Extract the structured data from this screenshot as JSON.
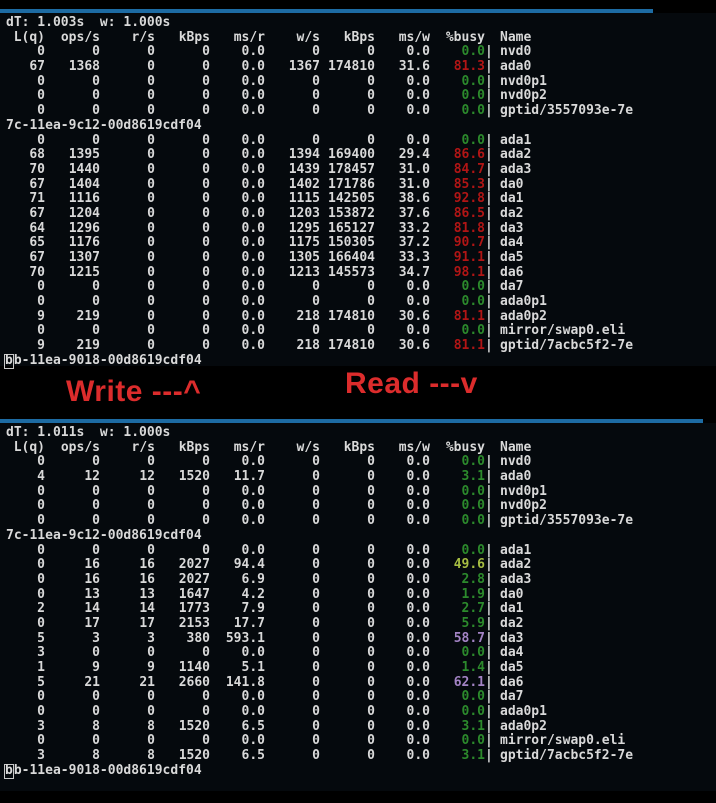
{
  "colors": {
    "page_bg": "#000000",
    "terminal_bg": "#05090d",
    "text": "#d9d9d9",
    "accent_bar": "#1d6ba3",
    "annotation_red": "#dc2c2c",
    "busy": {
      "green": "#2c8a2c",
      "lime": "#a6bd42",
      "purple": "#a383c4",
      "red": "#b11515"
    }
  },
  "annotations": {
    "write_label": "Write ---^",
    "read_label": "Read ---v"
  },
  "columns": [
    "L(q)",
    "ops/s",
    "r/s",
    "kBps",
    "ms/r",
    "w/s",
    "kBps",
    "ms/w",
    "%busy",
    "Name"
  ],
  "terminals": [
    {
      "id": "write",
      "dt_line": "dT: 1.003s  w: 1.000s",
      "rows": [
        [
          "0",
          "0",
          "0",
          "0",
          "0.0",
          "0",
          "0",
          "0.0",
          "0.0",
          "green",
          "nvd0"
        ],
        [
          "67",
          "1368",
          "0",
          "0",
          "0.0",
          "1367",
          "174810",
          "31.6",
          "81.3",
          "red",
          "ada0"
        ],
        [
          "0",
          "0",
          "0",
          "0",
          "0.0",
          "0",
          "0",
          "0.0",
          "0.0",
          "green",
          "nvd0p1"
        ],
        [
          "0",
          "0",
          "0",
          "0",
          "0.0",
          "0",
          "0",
          "0.0",
          "0.0",
          "green",
          "nvd0p2"
        ],
        [
          "0",
          "0",
          "0",
          "0",
          "0.0",
          "0",
          "0",
          "0.0",
          "0.0",
          "green",
          "gptid/3557093e-7e"
        ],
        {
          "wrap": "7c-11ea-9c12-00d8619cdf04",
          "cursor": false
        },
        [
          "0",
          "0",
          "0",
          "0",
          "0.0",
          "0",
          "0",
          "0.0",
          "0.0",
          "green",
          "ada1"
        ],
        [
          "68",
          "1395",
          "0",
          "0",
          "0.0",
          "1394",
          "169400",
          "29.4",
          "86.6",
          "red",
          "ada2"
        ],
        [
          "70",
          "1440",
          "0",
          "0",
          "0.0",
          "1439",
          "178457",
          "31.0",
          "84.7",
          "red",
          "ada3"
        ],
        [
          "67",
          "1404",
          "0",
          "0",
          "0.0",
          "1402",
          "171786",
          "31.0",
          "85.3",
          "red",
          "da0"
        ],
        [
          "71",
          "1116",
          "0",
          "0",
          "0.0",
          "1115",
          "142505",
          "38.6",
          "92.8",
          "red",
          "da1"
        ],
        [
          "67",
          "1204",
          "0",
          "0",
          "0.0",
          "1203",
          "153872",
          "37.6",
          "86.5",
          "red",
          "da2"
        ],
        [
          "64",
          "1296",
          "0",
          "0",
          "0.0",
          "1295",
          "165127",
          "33.2",
          "81.8",
          "red",
          "da3"
        ],
        [
          "65",
          "1176",
          "0",
          "0",
          "0.0",
          "1175",
          "150305",
          "37.2",
          "90.7",
          "red",
          "da4"
        ],
        [
          "67",
          "1307",
          "0",
          "0",
          "0.0",
          "1305",
          "166404",
          "33.3",
          "91.1",
          "red",
          "da5"
        ],
        [
          "70",
          "1215",
          "0",
          "0",
          "0.0",
          "1213",
          "145573",
          "34.7",
          "98.1",
          "red",
          "da6"
        ],
        [
          "0",
          "0",
          "0",
          "0",
          "0.0",
          "0",
          "0",
          "0.0",
          "0.0",
          "green",
          "da7"
        ],
        [
          "0",
          "0",
          "0",
          "0",
          "0.0",
          "0",
          "0",
          "0.0",
          "0.0",
          "green",
          "ada0p1"
        ],
        [
          "9",
          "219",
          "0",
          "0",
          "0.0",
          "218",
          "174810",
          "30.6",
          "81.1",
          "red",
          "ada0p2"
        ],
        [
          "0",
          "0",
          "0",
          "0",
          "0.0",
          "0",
          "0",
          "0.0",
          "0.0",
          "green",
          "mirror/swap0.eli"
        ],
        [
          "9",
          "219",
          "0",
          "0",
          "0.0",
          "218",
          "174810",
          "30.6",
          "81.1",
          "red",
          "gptid/7acbc5f2-7e"
        ],
        {
          "wrap": "bb-11ea-9018-00d8619cdf04",
          "cursor": true
        }
      ]
    },
    {
      "id": "read",
      "dt_line": "dT: 1.011s  w: 1.000s",
      "rows": [
        [
          "0",
          "0",
          "0",
          "0",
          "0.0",
          "0",
          "0",
          "0.0",
          "0.0",
          "green",
          "nvd0"
        ],
        [
          "4",
          "12",
          "12",
          "1520",
          "11.7",
          "0",
          "0",
          "0.0",
          "3.1",
          "green",
          "ada0"
        ],
        [
          "0",
          "0",
          "0",
          "0",
          "0.0",
          "0",
          "0",
          "0.0",
          "0.0",
          "green",
          "nvd0p1"
        ],
        [
          "0",
          "0",
          "0",
          "0",
          "0.0",
          "0",
          "0",
          "0.0",
          "0.0",
          "green",
          "nvd0p2"
        ],
        [
          "0",
          "0",
          "0",
          "0",
          "0.0",
          "0",
          "0",
          "0.0",
          "0.0",
          "green",
          "gptid/3557093e-7e"
        ],
        {
          "wrap": "7c-11ea-9c12-00d8619cdf04",
          "cursor": false
        },
        [
          "0",
          "0",
          "0",
          "0",
          "0.0",
          "0",
          "0",
          "0.0",
          "0.0",
          "green",
          "ada1"
        ],
        [
          "0",
          "16",
          "16",
          "2027",
          "94.4",
          "0",
          "0",
          "0.0",
          "49.6",
          "lime",
          "ada2"
        ],
        [
          "0",
          "16",
          "16",
          "2027",
          "6.9",
          "0",
          "0",
          "0.0",
          "2.8",
          "green",
          "ada3"
        ],
        [
          "0",
          "13",
          "13",
          "1647",
          "4.2",
          "0",
          "0",
          "0.0",
          "1.9",
          "green",
          "da0"
        ],
        [
          "2",
          "14",
          "14",
          "1773",
          "7.9",
          "0",
          "0",
          "0.0",
          "2.7",
          "green",
          "da1"
        ],
        [
          "0",
          "17",
          "17",
          "2153",
          "17.7",
          "0",
          "0",
          "0.0",
          "5.9",
          "green",
          "da2"
        ],
        [
          "5",
          "3",
          "3",
          "380",
          "593.1",
          "0",
          "0",
          "0.0",
          "58.7",
          "purple",
          "da3"
        ],
        [
          "3",
          "0",
          "0",
          "0",
          "0.0",
          "0",
          "0",
          "0.0",
          "0.0",
          "green",
          "da4"
        ],
        [
          "1",
          "9",
          "9",
          "1140",
          "5.1",
          "0",
          "0",
          "0.0",
          "1.4",
          "green",
          "da5"
        ],
        [
          "5",
          "21",
          "21",
          "2660",
          "141.8",
          "0",
          "0",
          "0.0",
          "62.1",
          "purple",
          "da6"
        ],
        [
          "0",
          "0",
          "0",
          "0",
          "0.0",
          "0",
          "0",
          "0.0",
          "0.0",
          "green",
          "da7"
        ],
        [
          "0",
          "0",
          "0",
          "0",
          "0.0",
          "0",
          "0",
          "0.0",
          "0.0",
          "green",
          "ada0p1"
        ],
        [
          "3",
          "8",
          "8",
          "1520",
          "6.5",
          "0",
          "0",
          "0.0",
          "3.1",
          "green",
          "ada0p2"
        ],
        [
          "0",
          "0",
          "0",
          "0",
          "0.0",
          "0",
          "0",
          "0.0",
          "0.0",
          "green",
          "mirror/swap0.eli"
        ],
        [
          "3",
          "8",
          "8",
          "1520",
          "6.5",
          "0",
          "0",
          "0.0",
          "3.1",
          "green",
          "gptid/7acbc5f2-7e"
        ],
        {
          "wrap": "bb-11ea-9018-00d8619cdf04",
          "cursor": true
        }
      ]
    }
  ]
}
